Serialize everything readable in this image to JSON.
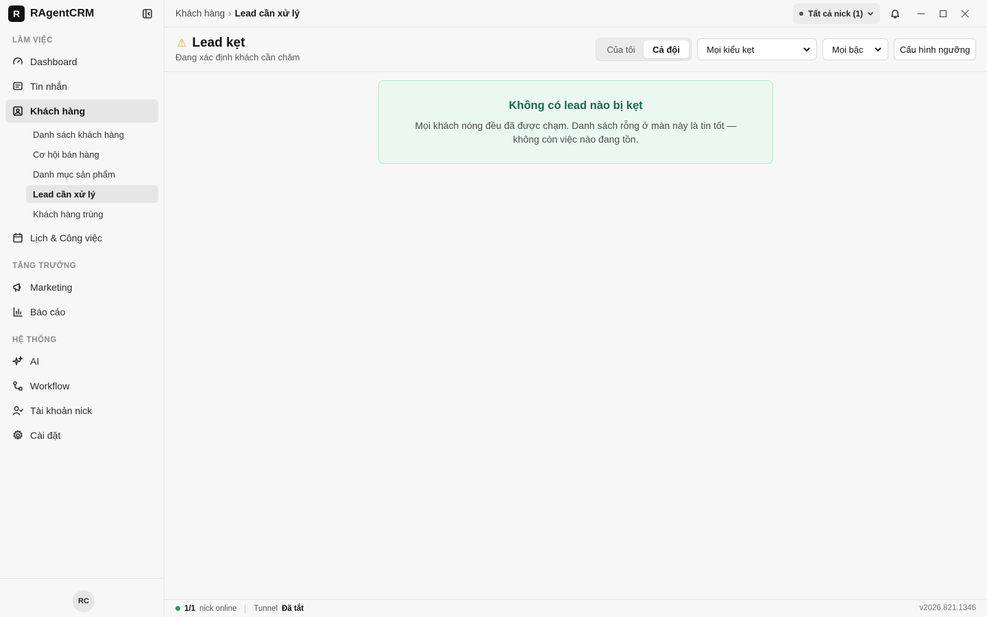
{
  "app": {
    "name": "RAgentCRM",
    "logo_letter": "R"
  },
  "sidebar": {
    "sections": [
      {
        "label": "LÀM VIỆC"
      },
      {
        "label": "TĂNG TRƯỞNG"
      },
      {
        "label": "HỆ THỐNG"
      }
    ],
    "items": [
      {
        "label": "Dashboard",
        "icon": "gauge-icon"
      },
      {
        "label": "Tin nhắn",
        "icon": "message-icon"
      },
      {
        "label": "Khách hàng",
        "icon": "contact-icon",
        "active": true
      },
      {
        "label": "Lịch & Công việc",
        "icon": "calendar-icon"
      },
      {
        "label": "Marketing",
        "icon": "megaphone-icon"
      },
      {
        "label": "Báo cáo",
        "icon": "bar-chart-icon"
      },
      {
        "label": "AI",
        "icon": "sparkles-icon"
      },
      {
        "label": "Workflow",
        "icon": "workflow-icon"
      },
      {
        "label": "Tài khoản nick",
        "icon": "user-check-icon"
      },
      {
        "label": "Cài đặt",
        "icon": "gear-icon"
      }
    ],
    "sub_items": [
      {
        "label": "Danh sách khách hàng"
      },
      {
        "label": "Cơ hội bán hàng"
      },
      {
        "label": "Danh mục sản phẩm"
      },
      {
        "label": "Lead cần xử lý",
        "active": true
      },
      {
        "label": "Khách hàng trùng"
      }
    ],
    "avatar_initials": "RC"
  },
  "topbar": {
    "breadcrumb": [
      "Khách hàng",
      "Lead cần xử lý"
    ],
    "breadcrumb_sep": "›",
    "nick_selector": "Tất cả nick (1)"
  },
  "page": {
    "title": "Lead kẹt",
    "title_icon": "⚠",
    "subtitle": "Đang xác định khách cần chăm",
    "segment": {
      "options": [
        "Của tôi",
        "Cả đội"
      ],
      "selected": "Cả đội"
    },
    "type_filter": "Mọi kiểu kẹt",
    "level_filter": "Mọi bậc",
    "config_button": "Cấu hình ngưỡng"
  },
  "empty_state": {
    "title": "Không có lead nào bị kẹt",
    "description": "Mọi khách nóng đều đã được chạm. Danh sách rỗng ở màn này là tin tốt — không còn việc nào đang tồn."
  },
  "statusbar": {
    "online_count": "1/1",
    "online_label": "nick online",
    "tunnel_label": "Tunnel",
    "tunnel_status": "Đã tắt",
    "version": "v2026.821.1346"
  },
  "colors": {
    "accent_green": "#1c6a49",
    "empty_bg": "#ebf8f2",
    "empty_border": "#b4e6cd",
    "online_dot": "#22a04b",
    "warning": "#e8a317"
  }
}
